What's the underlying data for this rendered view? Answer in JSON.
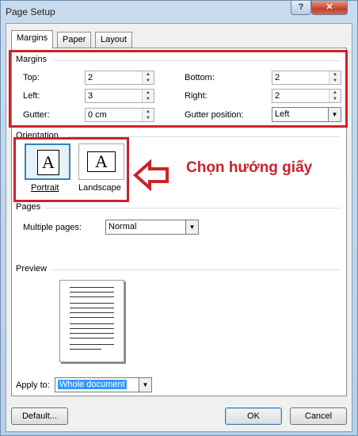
{
  "window": {
    "title": "Page Setup",
    "help_label": "?",
    "close_label": "✕"
  },
  "tabs": [
    {
      "label": "Margins",
      "active": true
    },
    {
      "label": "Paper",
      "active": false
    },
    {
      "label": "Layout",
      "active": false
    }
  ],
  "margins": {
    "section_label": "Margins",
    "top": {
      "label": "Top:",
      "value": "2"
    },
    "left": {
      "label": "Left:",
      "value": "3"
    },
    "gutter": {
      "label": "Gutter:",
      "value": "0 cm"
    },
    "bottom": {
      "label": "Bottom:",
      "value": "2"
    },
    "right": {
      "label": "Right:",
      "value": "2"
    },
    "gutter_position": {
      "label": "Gutter position:",
      "value": "Left"
    }
  },
  "orientation": {
    "section_label": "Orientation",
    "portrait_label": "Portrait",
    "landscape_label": "Landscape",
    "selected": "Portrait"
  },
  "annotation": {
    "text": "Chọn hướng giấy",
    "color": "#cc2229"
  },
  "pages": {
    "section_label": "Pages",
    "multiple_pages_label": "Multiple pages:",
    "multiple_pages_value": "Normal"
  },
  "preview": {
    "section_label": "Preview"
  },
  "apply_to": {
    "label": "Apply to:",
    "value": "Whole document"
  },
  "buttons": {
    "default_label": "Default...",
    "ok_label": "OK",
    "cancel_label": "Cancel"
  },
  "icons": {
    "page_glyph_letter": "A",
    "spin_up": "▲",
    "spin_down": "▼",
    "dropdown": "▼"
  }
}
